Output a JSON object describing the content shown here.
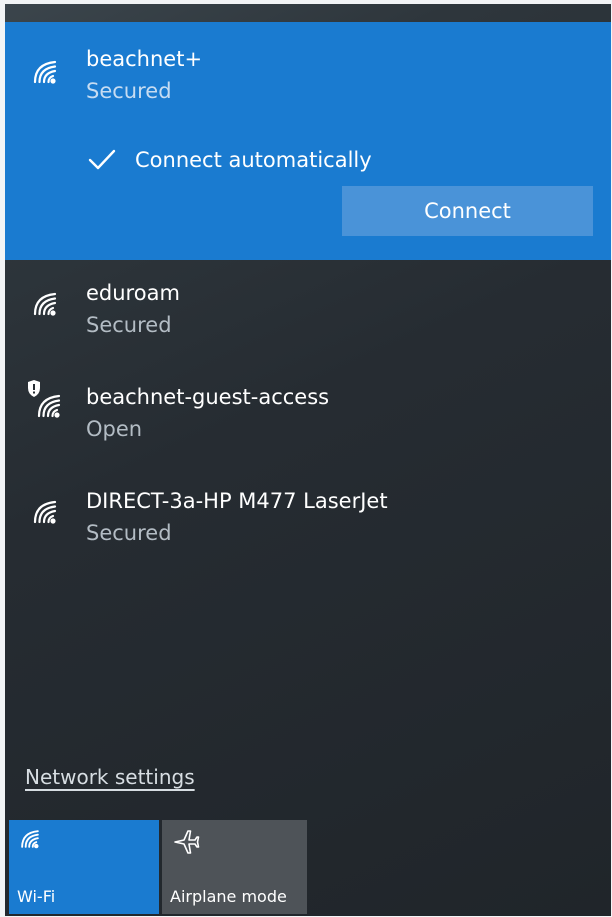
{
  "selected_network": {
    "name": "beachnet+",
    "status": "Secured",
    "auto_connect_label": "Connect automatically",
    "auto_connect_checked": true,
    "connect_label": "Connect",
    "icon": "wifi-signal-icon"
  },
  "networks": [
    {
      "name": "eduroam",
      "status": "Secured",
      "icon": "wifi-signal-icon"
    },
    {
      "name": "beachnet-guest-access",
      "status": "Open",
      "icon": "wifi-open-shield-icon"
    },
    {
      "name": "DIRECT-3a-HP M477 LaserJet",
      "status": "Secured",
      "icon": "wifi-signal-icon"
    }
  ],
  "footer": {
    "settings_link": "Network settings"
  },
  "quick_actions": [
    {
      "label": "Wi-Fi",
      "active": true,
      "icon": "wifi-icon"
    },
    {
      "label": "Airplane mode",
      "active": false,
      "icon": "airplane-icon"
    }
  ],
  "colors": {
    "accent": "#1a7bd0",
    "button": "#4a93d8",
    "panel": "#262c32",
    "tile_inactive": "#4e5358"
  }
}
